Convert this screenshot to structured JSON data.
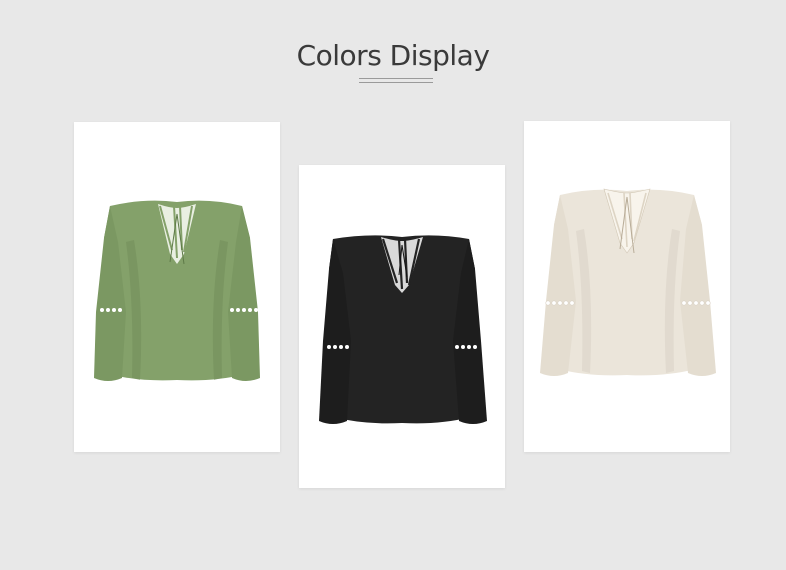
{
  "section": {
    "title": "Colors Display"
  },
  "products": [
    {
      "color_name": "green",
      "hex": "#84a16a",
      "shade": "#6f8c57",
      "lace": "#e9efe2"
    },
    {
      "color_name": "black",
      "hex": "#232323",
      "shade": "#111111",
      "lace": "#d9d9d9"
    },
    {
      "color_name": "beige",
      "hex": "#ebe5da",
      "shade": "#d8d0c3",
      "lace": "#f8f4ec"
    }
  ]
}
